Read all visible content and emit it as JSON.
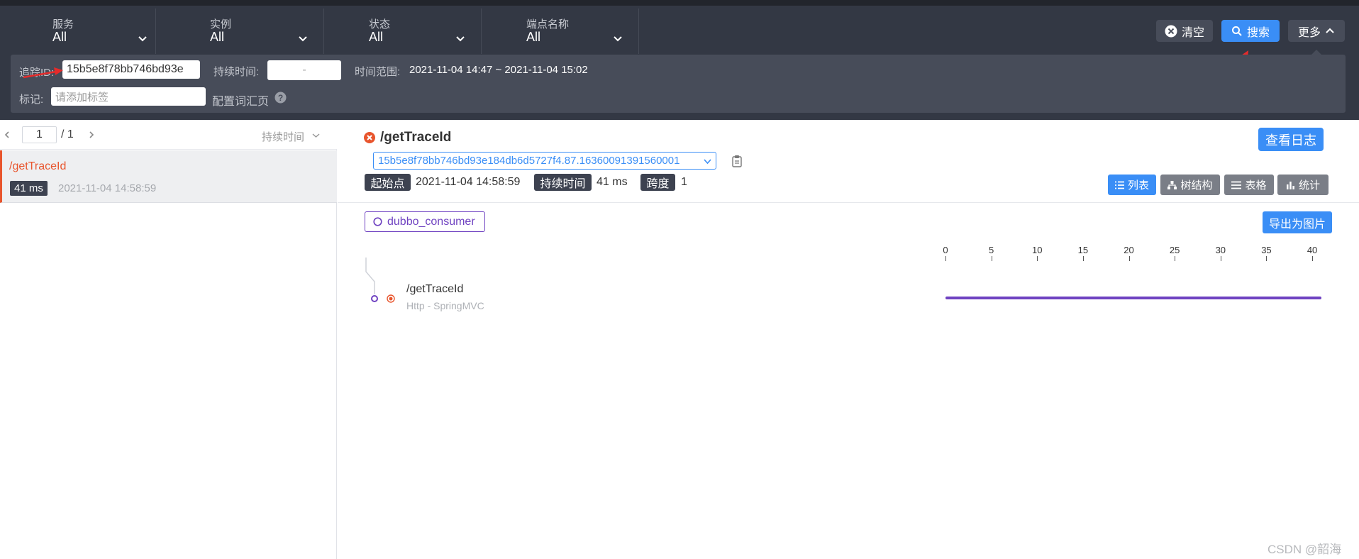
{
  "filters": [
    {
      "label": "服务",
      "value": "All"
    },
    {
      "label": "实例",
      "value": "All"
    },
    {
      "label": "状态",
      "value": "All"
    },
    {
      "label": "端点名称",
      "value": "All"
    }
  ],
  "toolbar": {
    "clear_label": "清空",
    "search_label": "搜索",
    "more_label": "更多"
  },
  "advanced": {
    "trace_id_label": "追踪ID:",
    "trace_id_value": "15b5e8f78bb746bd93e",
    "duration_label": "持续时间:",
    "duration_sep": "-",
    "time_range_label": "时间范围:",
    "time_range_value": "2021-11-04 14:47 ~ 2021-11-04 15:02",
    "tags_label": "标记:",
    "tags_placeholder": "请添加标签",
    "config_label": "配置词汇页"
  },
  "pager": {
    "page": "1",
    "total": "/ 1",
    "sort_label": "持续时间"
  },
  "trace_list": [
    {
      "name": "/getTraceId",
      "duration": "41 ms",
      "time": "2021-11-04 14:58:59"
    }
  ],
  "detail": {
    "title": "/getTraceId",
    "trace_id": "15b5e8f78bb746bd93e184db6d5727f4.87.16360091391560001",
    "view_logs_label": "查看日志",
    "start_label": "起始点",
    "start_value": "2021-11-04 14:58:59",
    "duration_label": "持续时间",
    "duration_value": "41 ms",
    "span_label": "跨度",
    "span_value": "1",
    "views": [
      "列表",
      "树结构",
      "表格",
      "统计"
    ],
    "service_chip": "dubbo_consumer",
    "export_label": "导出为图片",
    "axis_ticks": [
      "0",
      "5",
      "10",
      "15",
      "20",
      "25",
      "30",
      "35",
      "40"
    ],
    "span": {
      "name": "/getTraceId",
      "sub": "Http - SpringMVC",
      "start_ms": 0,
      "duration_ms": 41
    },
    "axis_max_ms": 41
  },
  "watermark": "CSDN @韶海",
  "colors": {
    "accent_blue": "#3a8ef6",
    "error_red": "#e8552d",
    "span_purple": "#6f42c1",
    "dark_bar": "#333844"
  }
}
